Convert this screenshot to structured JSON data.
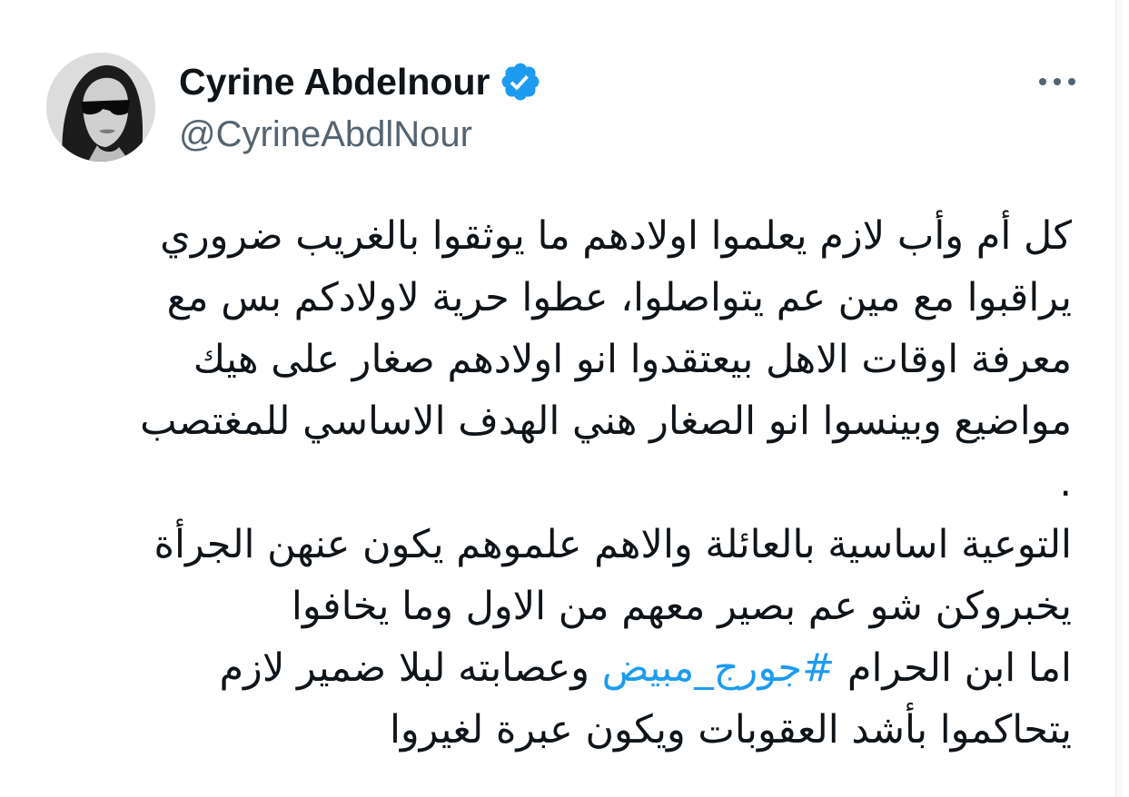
{
  "author": {
    "display_name": "Cyrine Abdelnour",
    "handle": "@CyrineAbdlNour",
    "verified": true,
    "avatar_icon": "profile-photo"
  },
  "menu": {
    "more_icon": "more-horizontal-icon"
  },
  "colors": {
    "text": "#0f1419",
    "secondary": "#536471",
    "link": "#1d9bf0",
    "verified_badge": "#1d9bf0"
  },
  "tweet": {
    "lines": [
      "كل أم وأب لازم يعلموا اولادهم ما يوثقوا بالغريب ضروري",
      "يراقبوا مع مين عم يتواصلوا، عطوا حرية لاولادكم بس مع",
      "معرفة اوقات الاهل بيعتقدوا انو اولادهم صغار على هيك",
      "مواضيع وبينسوا انو الصغار هني الهدف الاساسي للمغتصب",
      ".",
      "التوعية اساسية بالعائلة والاهم علموهم يكون عنهن الجرأة",
      "يخبروكن شو عم بصير معهم من الاول وما يخافوا"
    ],
    "hashtag_line_prefix": "اما ابن الحرام ",
    "hashtag": "#جورج_مبيض",
    "hashtag_line_suffix": " وعصابته  لبلا ضمير لازم",
    "last_line": "يتحاكموا بأشد العقوبات ويكون عبرة لغيروا"
  }
}
